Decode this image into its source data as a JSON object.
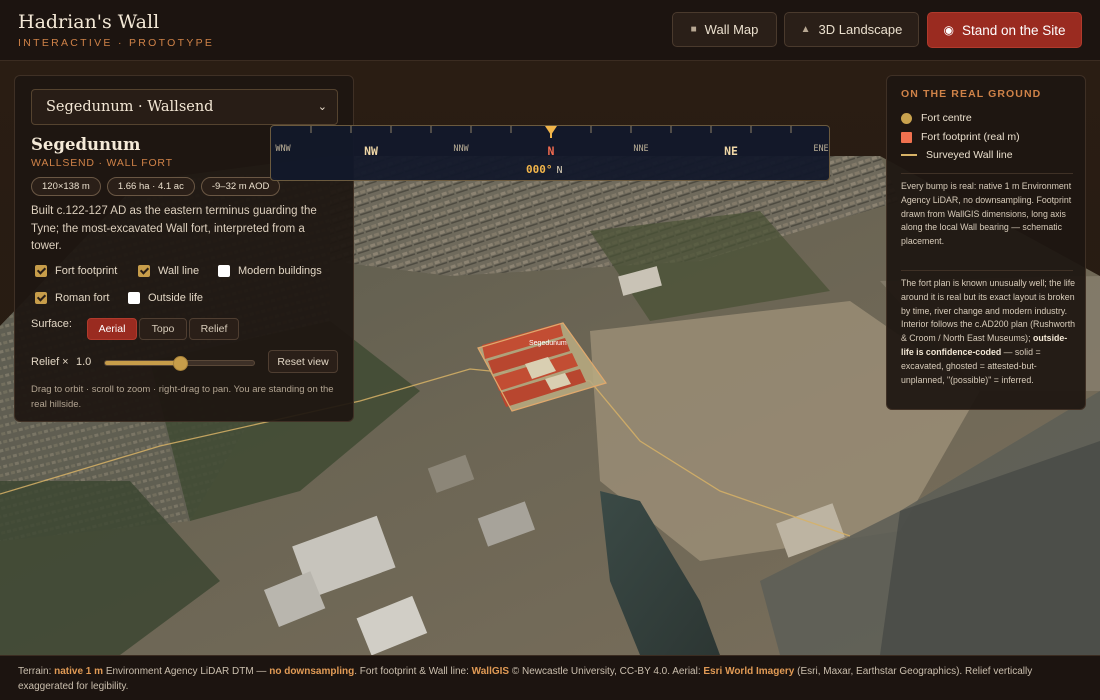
{
  "header": {
    "title": "Hadrian's Wall",
    "subtitle": "INTERACTIVE · PROTOTYPE",
    "buttons": {
      "wall_map": "Wall Map",
      "landscape": "3D Landscape",
      "stand": "Stand on the Site"
    },
    "active_button": "Stand on the Site"
  },
  "site_panel": {
    "selector_value": "Segedunum · Wallsend",
    "name": "Segedunum",
    "kind": "WALLSEND · WALL FORT",
    "chips": [
      "120×138 m",
      "1.66 ha · 4.1 ac",
      "-9–32 m AOD"
    ],
    "description": "Built c.122-127 AD as the eastern terminus guarding the Tyne; the most-excavated Wall fort, interpreted from a tower.",
    "layers": [
      {
        "label": "Fort footprint",
        "checked": true
      },
      {
        "label": "Wall line",
        "checked": true
      },
      {
        "label": "Modern buildings",
        "checked": false
      },
      {
        "label": "Roman fort",
        "checked": true
      },
      {
        "label": "Outside life",
        "checked": false
      }
    ],
    "surface_label": "Surface:",
    "surface_options": [
      "Aerial",
      "Topo",
      "Relief"
    ],
    "surface_selected": "Aerial",
    "relief_label": "Relief ×",
    "relief_value": "1.0",
    "relief_slider_fraction": 0.5,
    "reset_label": "Reset view",
    "hint": "Drag to orbit · scroll to zoom · right-drag to pan. You are standing on the real hillside."
  },
  "compass": {
    "directions": [
      "WNW",
      "NW",
      "NNW",
      "N",
      "NNE",
      "NE",
      "ENE"
    ],
    "heading": "000°",
    "heading_dir": "N"
  },
  "map": {
    "fort_label": "Segedunum"
  },
  "legend": {
    "heading": "ON THE REAL GROUND",
    "items": [
      "Fort centre",
      "Fort footprint (real m)",
      "Surveyed Wall line"
    ],
    "colors": {
      "fort_centre": "#c9a24e",
      "fort_footprint": "#f0714f",
      "wall_line": "#d7b266"
    },
    "note1": "Every bump is real: native 1 m Environment Agency LiDAR, no downsampling. Footprint drawn from WallGIS dimensions, long axis along the local Wall bearing — schematic placement.",
    "note2_a": "The fort plan is known unusually well; the life around it is real but its exact layout is broken by time, river change and modern industry. Interior follows the c.AD200 plan (Rushworth & Croom / North East Museums); ",
    "note2_b": "outside-life is confidence-coded",
    "note2_c": " — solid = excavated, ghosted = attested-but-unplanned, \"(possible)\" = inferred."
  },
  "footer": {
    "t1": "Terrain: ",
    "b1": "native 1 m",
    "t2": " Environment Agency LiDAR DTM — ",
    "b2": "no downsampling",
    "t3": ". Fort footprint & Wall line: ",
    "b3": "WallGIS",
    "t4": " © Newcastle University, CC-BY 4.0. Aerial: ",
    "b4": "Esri World Imagery",
    "t5": " (Esri, Maxar, Earthstar Geographics). Relief vertically exaggerated for legibility."
  },
  "colors": {
    "accent": "#9a2b20",
    "brand_orange": "#cf8248",
    "checkbox": "#c79d4a",
    "compass_bg": "#12182a",
    "heading": "#f2b54a"
  }
}
